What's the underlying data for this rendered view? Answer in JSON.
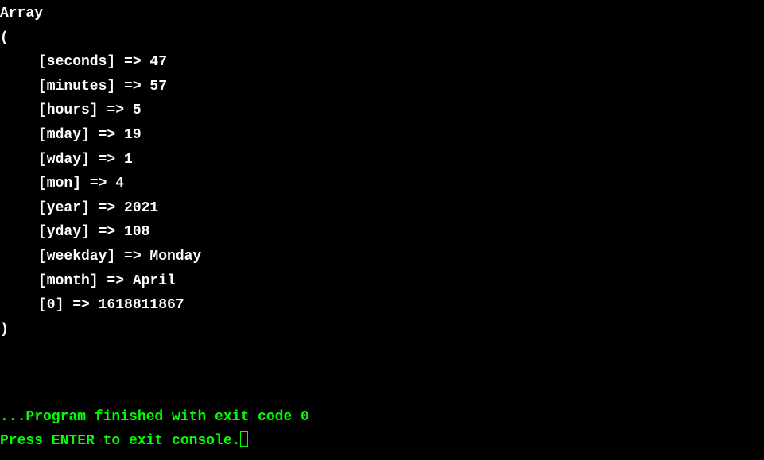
{
  "output": {
    "header": "Array",
    "openParen": "(",
    "closeParen": ")",
    "entries": [
      {
        "key": "seconds",
        "value": "47"
      },
      {
        "key": "minutes",
        "value": "57"
      },
      {
        "key": "hours",
        "value": "5"
      },
      {
        "key": "mday",
        "value": "19"
      },
      {
        "key": "wday",
        "value": "1"
      },
      {
        "key": "mon",
        "value": "4"
      },
      {
        "key": "year",
        "value": "2021"
      },
      {
        "key": "yday",
        "value": "108"
      },
      {
        "key": "weekday",
        "value": "Monday"
      },
      {
        "key": "month",
        "value": "April"
      },
      {
        "key": "0",
        "value": "1618811867"
      }
    ]
  },
  "footer": {
    "finished": "...Program finished with exit code 0",
    "prompt": "Press ENTER to exit console."
  }
}
